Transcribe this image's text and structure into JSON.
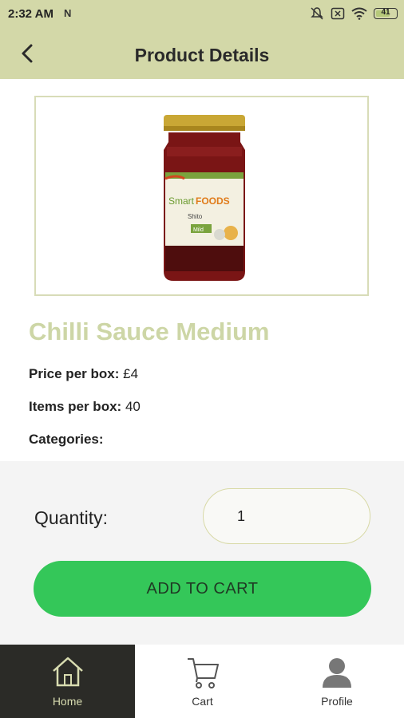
{
  "status_bar": {
    "time": "2:32 AM",
    "notification_glyph": "N",
    "battery_level": "41",
    "icons": [
      "mute-icon",
      "close-box-icon",
      "wifi-icon",
      "battery-icon"
    ]
  },
  "header": {
    "title": "Product Details",
    "back_icon": "chevron-left-icon"
  },
  "product": {
    "name": "Chilli Sauce Medium",
    "price_label": "Price per box:",
    "price_value": "£4",
    "items_label": "Items per box:",
    "items_value": "40",
    "categories_label": "Categories:",
    "jar_label_brand_a": "Smart",
    "jar_label_brand_b": "FOODS",
    "jar_label_line1": "Shito",
    "jar_label_line2": "Mild"
  },
  "cart_panel": {
    "quantity_label": "Quantity:",
    "quantity_value": "1",
    "add_button_label": "ADD TO CART"
  },
  "nav": {
    "items": [
      {
        "label": "Home",
        "icon": "home-icon",
        "active": true
      },
      {
        "label": "Cart",
        "icon": "cart-icon",
        "active": false
      },
      {
        "label": "Profile",
        "icon": "profile-icon",
        "active": false
      }
    ]
  },
  "colors": {
    "header_bg": "#d3d8a8",
    "product_name": "#cdd6a6",
    "add_button": "#34c759",
    "nav_active_bg": "#2b2b27"
  }
}
